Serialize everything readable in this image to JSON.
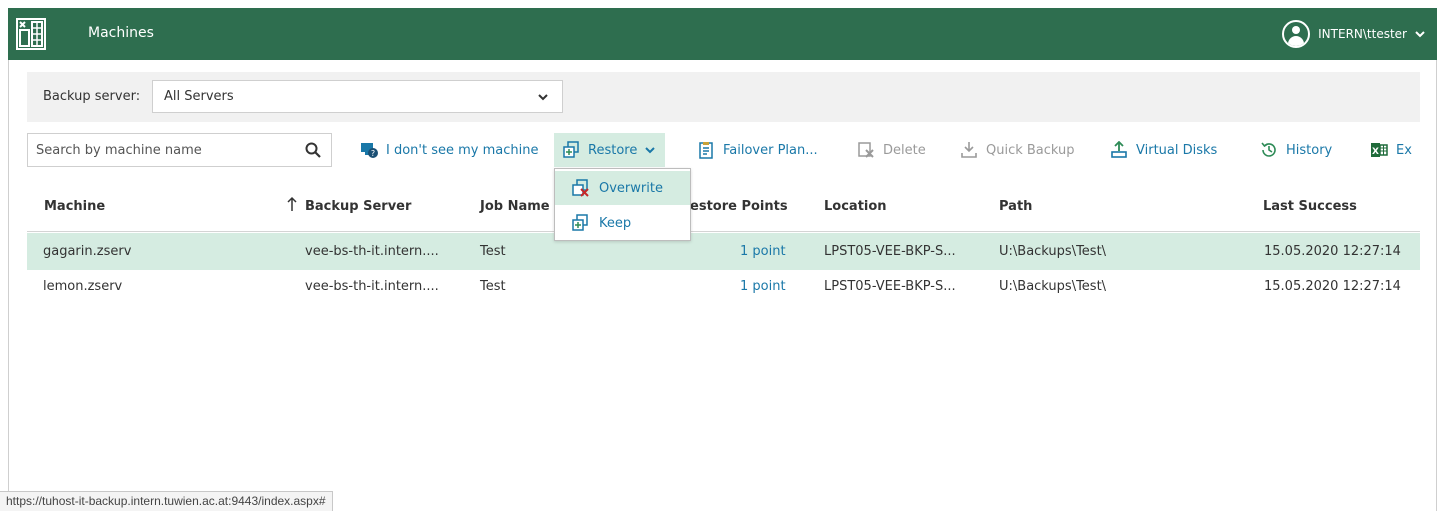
{
  "header": {
    "title": "Machines",
    "user": "INTERN\\ttester",
    "bg_color": "#2e6e4f"
  },
  "server_bar": {
    "label": "Backup server:",
    "selected": "All Servers"
  },
  "toolbar": {
    "search_placeholder": "Search by machine name",
    "dont_see": "I don't see my machine",
    "restore": "Restore",
    "failover": "Failover Plan...",
    "delete": "Delete",
    "quick_backup": "Quick Backup",
    "virtual_disks": "Virtual Disks",
    "history": "History",
    "export": "Ex"
  },
  "restore_menu": {
    "items": [
      {
        "label": "Overwrite"
      },
      {
        "label": "Keep"
      }
    ]
  },
  "table": {
    "columns": [
      "Machine",
      "Backup Server",
      "Job Name",
      "Restore Points",
      "Location",
      "Path",
      "Last Success"
    ],
    "rows": [
      {
        "machine": "gagarin.zserv",
        "backup_server": "vee-bs-th-it.intern....",
        "job": "Test",
        "points": "1 point",
        "location": "LPST05-VEE-BKP-S...",
        "path": "U:\\Backups\\Test\\",
        "last_success": "15.05.2020 12:27:14",
        "selected": true
      },
      {
        "machine": "lemon.zserv",
        "backup_server": "vee-bs-th-it.intern....",
        "job": "Test",
        "points": "1 point",
        "location": "LPST05-VEE-BKP-S...",
        "path": "U:\\Backups\\Test\\",
        "last_success": "15.05.2020 12:27:14",
        "selected": false
      }
    ]
  },
  "status_bar": {
    "url": "https://tuhost-it-backup.intern.tuwien.ac.at:9443/index.aspx#"
  },
  "colors": {
    "accent": "#2e6e4f",
    "link": "#1a78a8",
    "selection": "#d5ece1",
    "disabled": "#9a9a9a"
  }
}
